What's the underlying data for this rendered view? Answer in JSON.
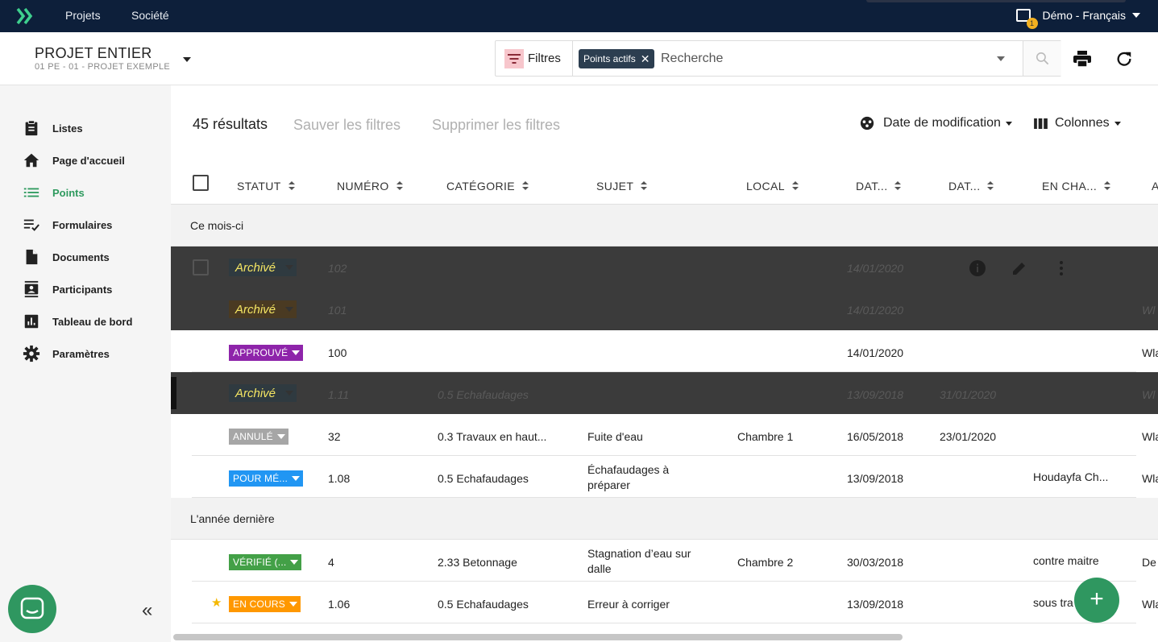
{
  "topnav": {
    "items": [
      "Projets",
      "Société"
    ],
    "account_label": "Démo - Français",
    "notification_count": "1"
  },
  "header": {
    "project_title": "PROJET ENTIER",
    "project_subtitle": "01 PE - 01 - PROJET EXEMPLE",
    "filters_label": "Filtres",
    "active_chip": "Points actifs",
    "search_placeholder": "Recherche"
  },
  "sidebar": {
    "items": [
      {
        "label": "Listes",
        "icon": "clipboard-icon"
      },
      {
        "label": "Page d'accueil",
        "icon": "home-icon"
      },
      {
        "label": "Points",
        "icon": "list-icon",
        "active": true
      },
      {
        "label": "Formulaires",
        "icon": "checklist-icon"
      },
      {
        "label": "Documents",
        "icon": "document-icon"
      },
      {
        "label": "Participants",
        "icon": "contacts-icon"
      },
      {
        "label": "Tableau de bord",
        "icon": "chart-icon"
      },
      {
        "label": "Paramètres",
        "icon": "gear-icon"
      }
    ],
    "collapse_label": "«"
  },
  "toolbar": {
    "results": "45 résultats",
    "save_filters": "Sauver les filtres",
    "delete_filters": "Supprimer les filtres",
    "sort_label": "Date de modification",
    "columns_label": "Colonnes"
  },
  "columns": [
    "STATUT",
    "NUMÉRO",
    "CATÉGORIE",
    "SUJET",
    "LOCAL",
    "DAT...",
    "DAT...",
    "EN CHA...",
    "A"
  ],
  "groups": [
    "Ce mois-ci",
    "L'année dernière"
  ],
  "rows": [
    {
      "status": "Archivé",
      "numero": "102",
      "categorie": "",
      "sujet": "",
      "local": "",
      "date1": "14/01/2020",
      "date2": "",
      "charge": "",
      "extra": ""
    },
    {
      "status": "Archivé",
      "numero": "101",
      "categorie": "",
      "sujet": "",
      "local": "",
      "date1": "14/01/2020",
      "date2": "",
      "charge": "",
      "extra": "Wl"
    },
    {
      "status": "APPROUVÉ",
      "numero": "100",
      "categorie": "",
      "sujet": "",
      "local": "",
      "date1": "14/01/2020",
      "date2": "",
      "charge": "",
      "extra": "Wla"
    },
    {
      "status": "Archivé",
      "numero": "1.11",
      "categorie": "0.5 Echafaudages",
      "sujet": "",
      "local": "",
      "date1": "13/09/2018",
      "date2": "31/01/2020",
      "charge": "",
      "extra": "Wl"
    },
    {
      "status": "ANNULÉ",
      "numero": "32",
      "categorie": "0.3 Travaux en haut...",
      "sujet": "Fuite d'eau",
      "local": "Chambre 1",
      "date1": "16/05/2018",
      "date2": "23/01/2020",
      "charge": "",
      "extra": "Wla"
    },
    {
      "status": "POUR MÉ...",
      "numero": "1.08",
      "categorie": "0.5 Echafaudages",
      "sujet": "Échafaudages à préparer",
      "local": "",
      "date1": "13/09/2018",
      "date2": "",
      "charge": "Houdayfa Ch...",
      "extra": "Wla"
    },
    {
      "status": "VÉRIFIÉ (...",
      "numero": "4",
      "categorie": "2.33 Betonnage",
      "sujet": "Stagnation d’eau sur dalle",
      "local": "Chambre 2",
      "date1": "30/03/2018",
      "date2": "",
      "charge": "contre maitre",
      "extra": "De"
    },
    {
      "status": "EN COURS",
      "numero": "1.06",
      "categorie": "0.5 Echafaudages",
      "sujet": "Erreur à corriger",
      "local": "",
      "date1": "13/09/2018",
      "date2": "",
      "charge": "sous tra",
      "extra": "Wla"
    }
  ],
  "fab_label": "+",
  "colors": {
    "accent": "#2e9a5e",
    "topbar": "#0d1f3a",
    "approved": "#8e24aa",
    "cancelled": "#9e9e9e",
    "pending": "#2196f3",
    "verified": "#43a047",
    "in_progress": "#ff9800",
    "archived_row": "#3b3b3b"
  }
}
